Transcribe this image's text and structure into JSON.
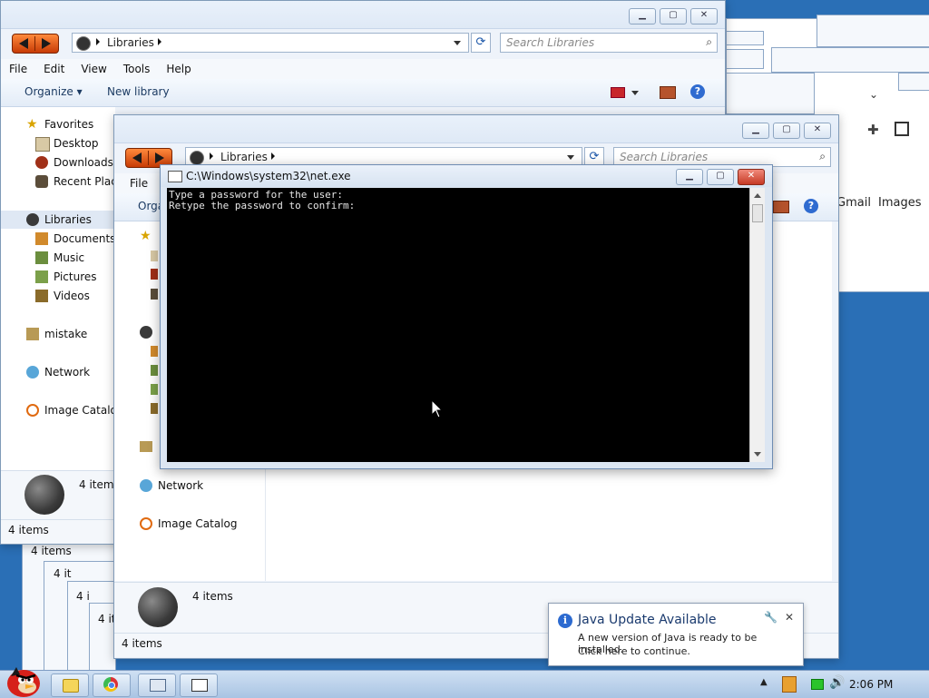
{
  "explorer_back": {
    "breadcrumb": "Libraries",
    "search_placeholder": "Search Libraries",
    "menu": [
      "File",
      "Edit",
      "View",
      "Tools",
      "Help"
    ],
    "cmd": {
      "organize": "Organize",
      "new_library": "New library"
    },
    "nav": {
      "favorites": "Favorites",
      "desktop": "Desktop",
      "downloads": "Downloads",
      "recent": "Recent Place",
      "libraries": "Libraries",
      "documents": "Documents",
      "music": "Music",
      "pictures": "Pictures",
      "videos": "Videos",
      "mistake": "mistake",
      "network": "Network",
      "image_catalog": "Image Catalog"
    },
    "details_count": "4 items",
    "status": "4 items"
  },
  "explorer_front": {
    "breadcrumb": "Libraries",
    "search_placeholder": "Search Libraries",
    "menu": [
      "File"
    ],
    "cmd_partial": "Orga",
    "nav": {
      "network": "Network",
      "image_catalog": "Image Catalog"
    },
    "details_count": "4 items",
    "status": "4 items"
  },
  "cascade_status": [
    "4 items",
    "4 it",
    "4 i",
    "4 it"
  ],
  "console": {
    "title": "C:\\Windows\\system32\\net.exe",
    "lines": [
      "Type a password for the user:",
      "Retype the password to confirm:"
    ]
  },
  "browser_bg": {
    "links": [
      "Gmail",
      "Images"
    ]
  },
  "java_notification": {
    "title": "Java Update Available",
    "line1": "A new version of Java is ready to be installed.",
    "line2": "Click here to continue."
  },
  "taskbar": {
    "clock": "2:06 PM"
  },
  "colors": {
    "console_bg": "#000000",
    "accent_orange": "#e05a12",
    "desktop": "#2a6fb6"
  }
}
